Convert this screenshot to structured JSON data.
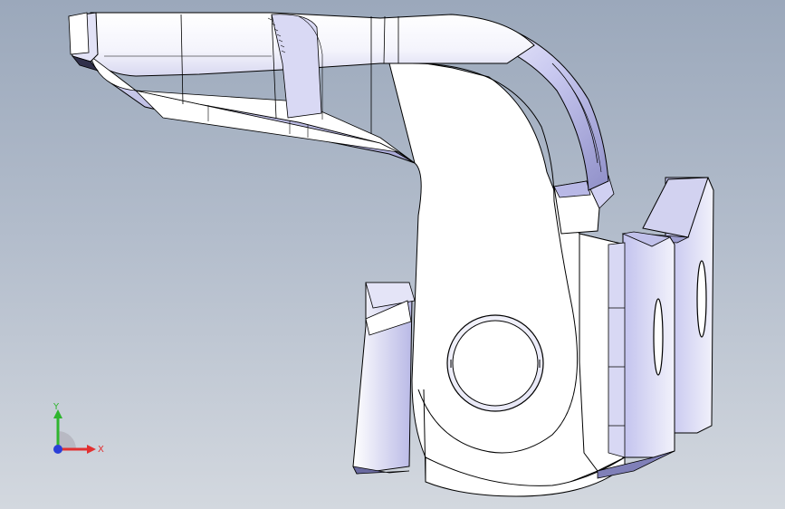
{
  "viewport": {
    "background_top": "#9ba8bb",
    "background_bottom": "#d3d8df",
    "model_face_color": "#ffffff",
    "model_shade_color": "#c6c6f0",
    "model_edge_color": "#000000"
  },
  "triad": {
    "x_label": "X",
    "y_label": "Y",
    "x_color": "#e23030",
    "y_color": "#2fb52f",
    "z_color": "#2a3fd8"
  }
}
